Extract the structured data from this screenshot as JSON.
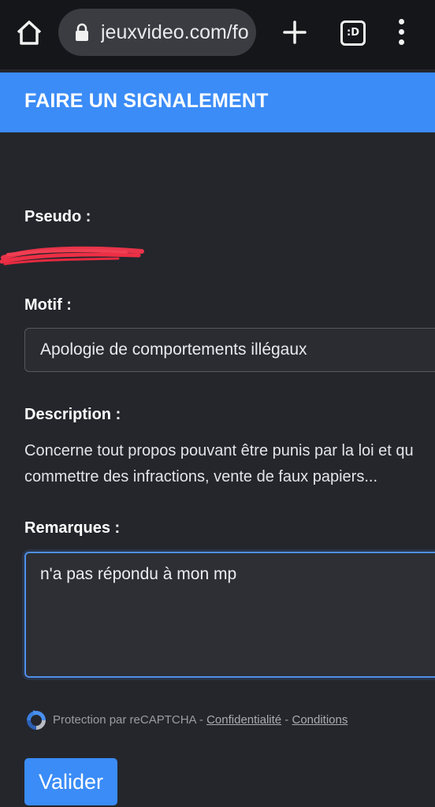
{
  "browser": {
    "url": "jeuxvideo.com/fo",
    "tab_count_label": ":D",
    "icons": [
      "home-icon",
      "lock-icon",
      "plus-icon",
      "tabs-icon",
      "more-vert-icon"
    ]
  },
  "header": {
    "title": "FAIRE UN SIGNALEMENT",
    "color": "#3b8cf7"
  },
  "form": {
    "pseudo_label": "Pseudo :",
    "motif_label": "Motif :",
    "motif_value": "Apologie de comportements illégaux",
    "description_label": "Description :",
    "description_lines": [
      "Concerne tout propos pouvant être punis par la loi et qu",
      "commettre des infractions, vente de faux papiers..."
    ],
    "remarques_label": "Remarques :",
    "remarques_value": "n'a pas répondu à mon mp"
  },
  "recaptcha": {
    "text": "Protection par reCAPTCHA - ",
    "privacy_link": "Confidentialité",
    "separator": " - ",
    "terms_link": "Conditions"
  },
  "submit_label": "Valider"
}
